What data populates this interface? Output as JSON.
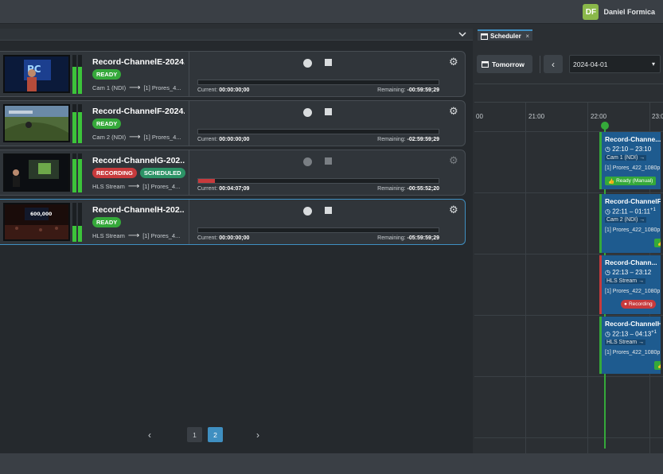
{
  "user": {
    "initials": "DF",
    "name": "Daniel Formica"
  },
  "recordings": [
    {
      "title": "Record-ChannelE-2024...",
      "badges": [
        {
          "label": "READY",
          "kind": "ready"
        }
      ],
      "source": "Cam 1 (NDI)",
      "destination": "[1] Prores_4...",
      "current_label": "Current:",
      "current": "00:00:00;00",
      "remaining_label": "Remaining:",
      "remaining": "-00:59:59;29",
      "progress": 0
    },
    {
      "title": "Record-ChannelF-2024...",
      "badges": [
        {
          "label": "READY",
          "kind": "ready"
        }
      ],
      "source": "Cam 2 (NDI)",
      "destination": "[1] Prores_4...",
      "current_label": "Current:",
      "current": "00:00:00;00",
      "remaining_label": "Remaining:",
      "remaining": "-02:59:59;29",
      "progress": 0
    },
    {
      "title": "Record-ChannelG-202...",
      "badges": [
        {
          "label": "RECORDING",
          "kind": "rec"
        },
        {
          "label": "SCHEDULED",
          "kind": "sched"
        }
      ],
      "source": "HLS Stream",
      "destination": "[1] Prores_4...",
      "current_label": "Current:",
      "current": "00:04:07;09",
      "remaining_label": "Remaining:",
      "remaining": "-00:55:52;20",
      "progress": 0.07
    },
    {
      "title": "Record-ChannelH-202...",
      "badges": [
        {
          "label": "READY",
          "kind": "ready"
        }
      ],
      "source": "HLS Stream",
      "destination": "[1] Prores_4...",
      "current_label": "Current:",
      "current": "00:00:00;00",
      "remaining_label": "Remaining:",
      "remaining": "-05:59:59;29",
      "progress": 0
    }
  ],
  "pager": {
    "pages": [
      "1",
      "2"
    ],
    "current": "2"
  },
  "scheduler": {
    "tab_label": "Scheduler",
    "tomorrow_label": "Tomorrow",
    "date": "2024-04-01",
    "hours": [
      "00",
      "21:00",
      "22:00",
      "23:0"
    ],
    "events": [
      {
        "title": "Record-Channe...",
        "time": "22:10 – 23:10",
        "sup": "",
        "source": "Cam 1 (NDI)",
        "dest": "[1] Prores_422_1080p",
        "badge": "Ready (Manual)",
        "badge_kind": "green"
      },
      {
        "title": "Record-ChannelF-",
        "time": "22:11 – 01:11",
        "sup": "+1",
        "source": "Cam 2 (NDI)",
        "dest": "[1] Prores_422_1080p",
        "badge": "",
        "badge_kind": "green"
      },
      {
        "title": "Record-Chann...",
        "time": "22:13 – 23:12",
        "sup": "",
        "source": "HLS Stream",
        "dest": "[1] Prores_422_1080p",
        "badge": "Recording",
        "badge_kind": "red"
      },
      {
        "title": "Record-ChannelH",
        "time": "22:13 – 04:13",
        "sup": "+1",
        "source": "HLS Stream",
        "dest": "[1] Prores_422_1080p",
        "badge": "",
        "badge_kind": "green"
      }
    ]
  },
  "colors": {
    "accent": "#3f8fc1",
    "ready": "#35a93a",
    "recording": "#c83a3c",
    "scheduled": "#2c9366",
    "event": "#1e5b8f"
  },
  "icons": {
    "record": "record-icon",
    "stop": "stop-icon",
    "settings": "gear-icon",
    "calendar": "calendar-icon",
    "clock": "clock-icon",
    "thumbs_up": "thumbs-up-icon"
  }
}
